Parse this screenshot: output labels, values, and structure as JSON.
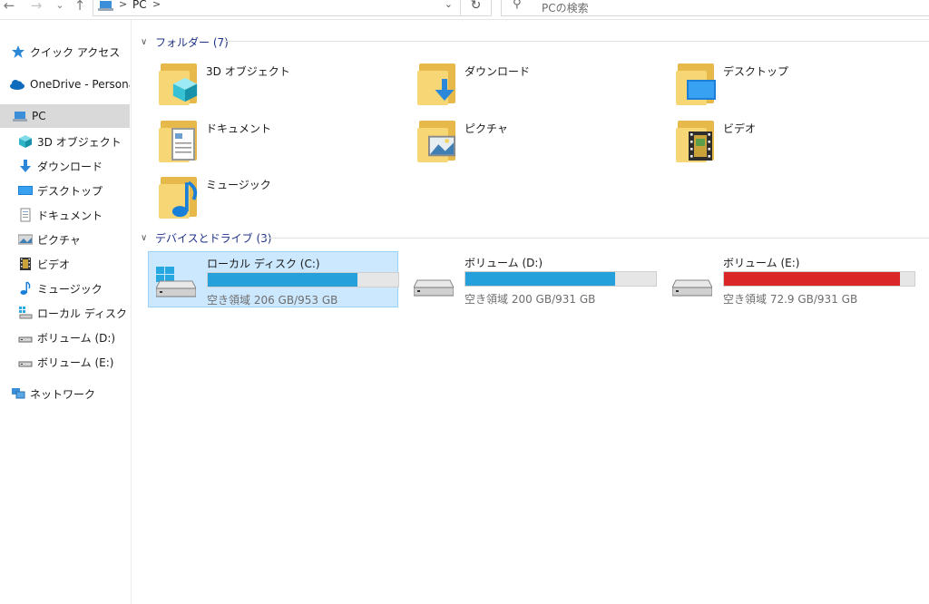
{
  "toolbar": {
    "back": "←",
    "forward": "→",
    "recent": "⌄",
    "up": "↑",
    "breadcrumb_sep": ">",
    "breadcrumb": "PC",
    "address_dropdown": "⌄",
    "refresh": "↻",
    "search_icon": "⚲",
    "search_placeholder": "PCの検索"
  },
  "sidebar": {
    "items": [
      {
        "label": "クイック アクセス",
        "icon": "star-icon"
      },
      {
        "label": "OneDrive - Personal",
        "icon": "cloud-icon"
      },
      {
        "label": "PC",
        "icon": "computer-icon",
        "selected": true
      },
      {
        "label": "3D オブジェクト",
        "icon": "cube-icon"
      },
      {
        "label": "ダウンロード",
        "icon": "download-arrow-icon"
      },
      {
        "label": "デスクトップ",
        "icon": "desktop-icon"
      },
      {
        "label": "ドキュメント",
        "icon": "document-icon"
      },
      {
        "label": "ピクチャ",
        "icon": "picture-icon"
      },
      {
        "label": "ビデオ",
        "icon": "film-icon"
      },
      {
        "label": "ミュージック",
        "icon": "music-note-icon"
      },
      {
        "label": "ローカル ディスク (C:)",
        "icon": "windows-drive-icon"
      },
      {
        "label": "ボリューム (D:)",
        "icon": "drive-icon"
      },
      {
        "label": "ボリューム (E:)",
        "icon": "drive-icon"
      },
      {
        "label": "ネットワーク",
        "icon": "network-icon"
      }
    ]
  },
  "folders_group": {
    "title": "フォルダー (7)",
    "items": [
      {
        "label": "3D オブジェクト",
        "overlay": "cube"
      },
      {
        "label": "ダウンロード",
        "overlay": "download"
      },
      {
        "label": "デスクトップ",
        "overlay": "desktop"
      },
      {
        "label": "ドキュメント",
        "overlay": "document"
      },
      {
        "label": "ピクチャ",
        "overlay": "picture"
      },
      {
        "label": "ビデオ",
        "overlay": "film"
      },
      {
        "label": "ミュージック",
        "overlay": "music"
      }
    ]
  },
  "drives_group": {
    "title": "デバイスとドライブ (3)",
    "items": [
      {
        "label": "ローカル ディスク (C:)",
        "free": "空き領域 206 GB/953 GB",
        "used_fraction": 0.784,
        "bar_color": "#26a0da",
        "selected": true,
        "windows": true
      },
      {
        "label": "ボリューム (D:)",
        "free": "空き領域 200 GB/931 GB",
        "used_fraction": 0.785,
        "bar_color": "#26a0da",
        "selected": false,
        "windows": false
      },
      {
        "label": "ボリューム (E:)",
        "free": "空き領域 72.9 GB/931 GB",
        "used_fraction": 0.922,
        "bar_color": "#da2626",
        "selected": false,
        "windows": false
      }
    ]
  }
}
